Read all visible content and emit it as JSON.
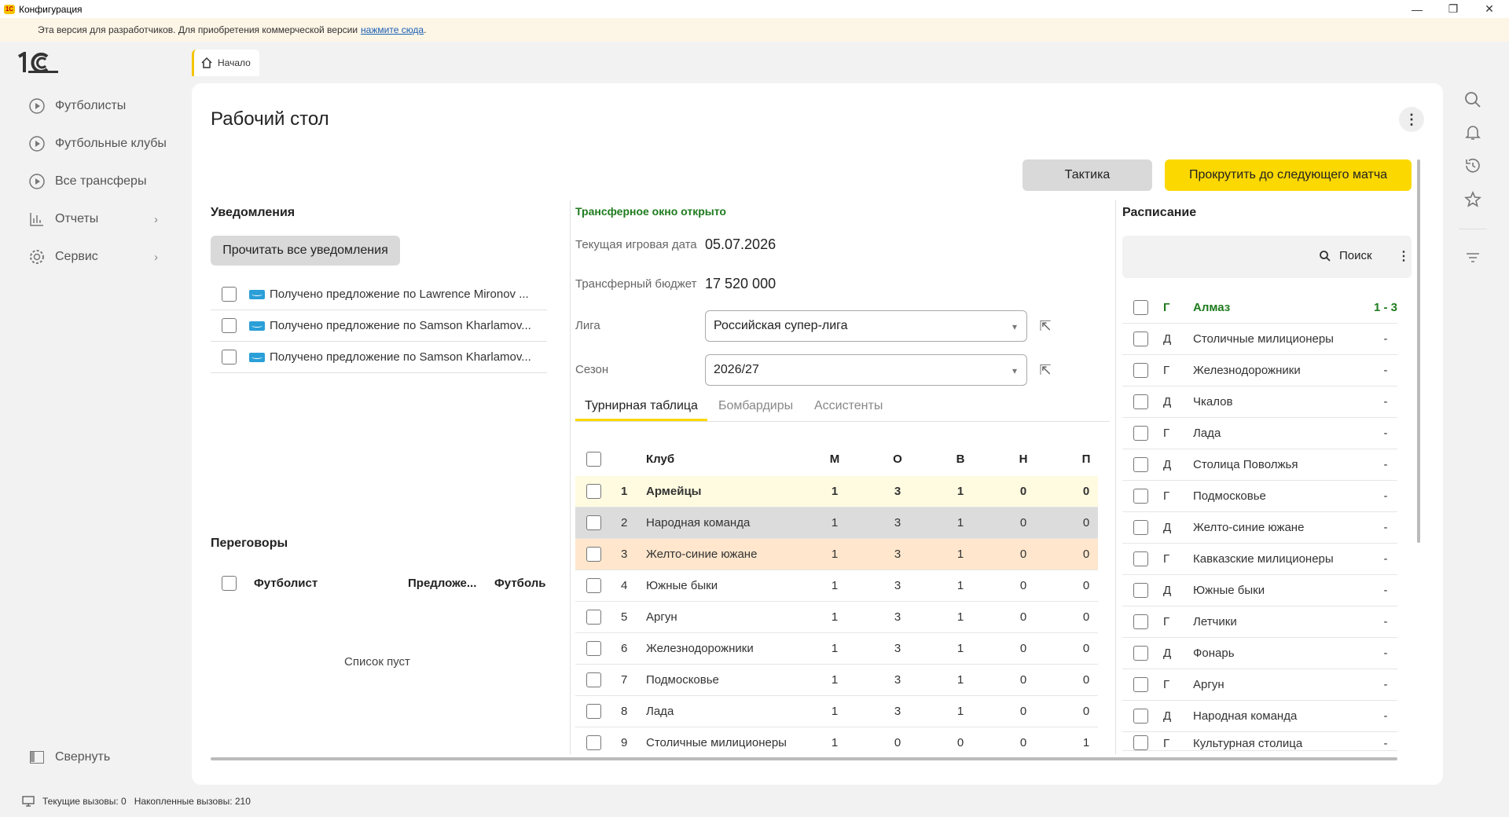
{
  "window": {
    "title": "Конфигурация"
  },
  "notice": {
    "text": "Эта версия для разработчиков. Для приобретения коммерческой версии",
    "link": "нажмите сюда",
    "tail": "."
  },
  "tab": {
    "home": "Начало"
  },
  "sidebar": {
    "items": [
      {
        "label": "Футболисты"
      },
      {
        "label": "Футбольные клубы"
      },
      {
        "label": "Все трансферы"
      },
      {
        "label": "Отчеты"
      },
      {
        "label": "Сервис"
      }
    ],
    "collapse": "Свернуть"
  },
  "page": {
    "title": "Рабочий стол"
  },
  "toolbar": {
    "tactics": "Тактика",
    "next_match": "Прокрутить до следующего матча"
  },
  "notifications": {
    "title": "Уведомления",
    "read_all": "Прочитать все уведомления",
    "items": [
      {
        "text": "Получено предложение по Lawrence Mironov ..."
      },
      {
        "text": "Получено предложение по Samson Kharlamov..."
      },
      {
        "text": "Получено предложение по Samson Kharlamov..."
      }
    ]
  },
  "negotiations": {
    "title": "Переговоры",
    "col_player": "Футболист",
    "col_offer": "Предложе...",
    "col_club": "Футболь",
    "empty": "Список пуст"
  },
  "info": {
    "transfer_window": "Трансферное окно открыто",
    "date_label": "Текущая игровая дата",
    "date_value": "05.07.2026",
    "budget_label": "Трансферный бюджет",
    "budget_value": "17 520 000",
    "league_label": "Лига",
    "league_value": "Российская супер-лига",
    "season_label": "Сезон",
    "season_value": "2026/27"
  },
  "tabs": {
    "standings": "Турнирная таблица",
    "scorers": "Бомбардиры",
    "assists": "Ассистенты"
  },
  "standings": {
    "headers": {
      "club": "Клуб",
      "m": "М",
      "o": "О",
      "v": "В",
      "n": "Н",
      "p": "П"
    },
    "rows": [
      {
        "n": "1",
        "club": "Армейцы",
        "m": "1",
        "o": "3",
        "v": "1",
        "nn": "0",
        "p": "0"
      },
      {
        "n": "2",
        "club": "Народная команда",
        "m": "1",
        "o": "3",
        "v": "1",
        "nn": "0",
        "p": "0"
      },
      {
        "n": "3",
        "club": "Желто-синие южане",
        "m": "1",
        "o": "3",
        "v": "1",
        "nn": "0",
        "p": "0"
      },
      {
        "n": "4",
        "club": "Южные быки",
        "m": "1",
        "o": "3",
        "v": "1",
        "nn": "0",
        "p": "0"
      },
      {
        "n": "5",
        "club": "Аргун",
        "m": "1",
        "o": "3",
        "v": "1",
        "nn": "0",
        "p": "0"
      },
      {
        "n": "6",
        "club": "Железнодорожники",
        "m": "1",
        "o": "3",
        "v": "1",
        "nn": "0",
        "p": "0"
      },
      {
        "n": "7",
        "club": "Подмосковье",
        "m": "1",
        "o": "3",
        "v": "1",
        "nn": "0",
        "p": "0"
      },
      {
        "n": "8",
        "club": "Лада",
        "m": "1",
        "o": "3",
        "v": "1",
        "nn": "0",
        "p": "0"
      },
      {
        "n": "9",
        "club": "Столичные милиционеры",
        "m": "1",
        "o": "0",
        "v": "0",
        "nn": "0",
        "p": "1"
      }
    ]
  },
  "schedule": {
    "title": "Расписание",
    "search": "Поиск",
    "rows": [
      {
        "hg": "Г",
        "team": "Алмаз",
        "score": "1 - 3"
      },
      {
        "hg": "Д",
        "team": "Столичные милиционеры",
        "score": "-"
      },
      {
        "hg": "Г",
        "team": "Железнодорожники",
        "score": "-"
      },
      {
        "hg": "Д",
        "team": "Чкалов",
        "score": "-"
      },
      {
        "hg": "Г",
        "team": "Лада",
        "score": "-"
      },
      {
        "hg": "Д",
        "team": "Столица Поволжья",
        "score": "-"
      },
      {
        "hg": "Г",
        "team": "Подмосковье",
        "score": "-"
      },
      {
        "hg": "Д",
        "team": "Желто-синие южане",
        "score": "-"
      },
      {
        "hg": "Г",
        "team": "Кавказские милиционеры",
        "score": "-"
      },
      {
        "hg": "Д",
        "team": "Южные быки",
        "score": "-"
      },
      {
        "hg": "Г",
        "team": "Летчики",
        "score": "-"
      },
      {
        "hg": "Д",
        "team": "Фонарь",
        "score": "-"
      },
      {
        "hg": "Г",
        "team": "Аргун",
        "score": "-"
      },
      {
        "hg": "Д",
        "team": "Народная команда",
        "score": "-"
      },
      {
        "hg": "Г",
        "team": "Культурная столица",
        "score": "-"
      }
    ]
  },
  "statusbar": {
    "current_calls": "Текущие вызовы: 0",
    "accum_calls": "Накопленные вызовы: 210"
  },
  "colors": {
    "accent_yellow": "#fbd800",
    "leader_row": "#fffbe0",
    "selected_row": "#dcdcdc",
    "own_row": "#ffe6cc",
    "transfer_green": "#1e7b1e"
  }
}
